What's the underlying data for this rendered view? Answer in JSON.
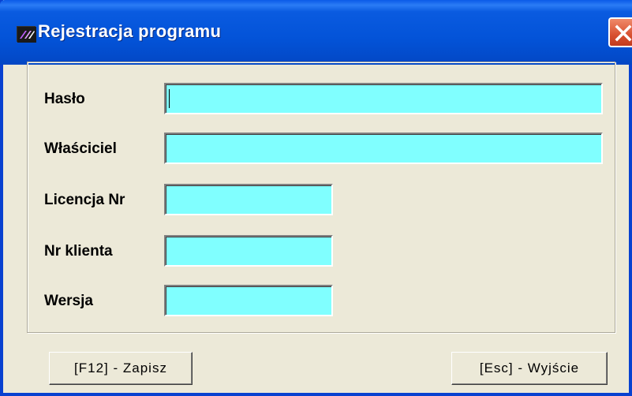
{
  "window": {
    "title": "Rejestracja programu",
    "icon": "app-logo-icon",
    "close_icon": "close-icon",
    "colors": {
      "titlebar": "#0353d8",
      "field_bg": "#80ffff",
      "close_bg": "#d85030",
      "window_bg": "#ece9d8"
    }
  },
  "form": {
    "fields": [
      {
        "label": "Hasło",
        "value": ""
      },
      {
        "label": "Właściciel",
        "value": ""
      },
      {
        "label": "Licencja Nr",
        "value": ""
      },
      {
        "label": "Nr klienta",
        "value": ""
      },
      {
        "label": "Wersja",
        "value": ""
      }
    ]
  },
  "buttons": {
    "save": "[F12] - Zapisz",
    "exit": "[Esc] - Wyjście"
  }
}
